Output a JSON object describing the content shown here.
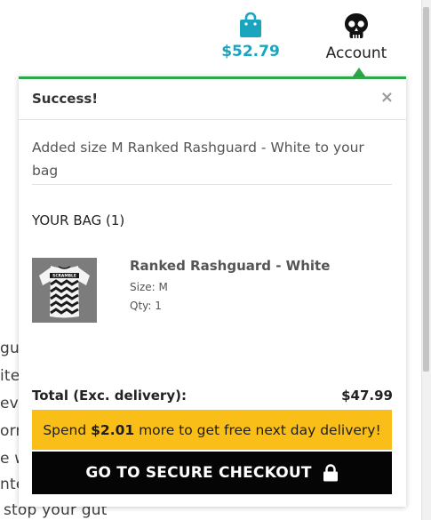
{
  "header": {
    "bag_total": "$52.79",
    "account_label": "Account",
    "brand_color": "#1aa5bf",
    "success_color": "#2fa84a"
  },
  "background_text": [
    "gui",
    "ite",
    "eve",
    "orr",
    "e w",
    "nte",
    "stop your gut"
  ],
  "popup": {
    "title": "Success!",
    "close_label": "×",
    "added_message": "Added size M Ranked Rashguard - White to your bag",
    "bag_heading": "YOUR BAG (1)",
    "item": {
      "name": "Ranked Rashguard - White",
      "size": "Size: M",
      "qty": "Qty: 1",
      "thumbnail_text": "SCRAMBLE"
    },
    "total_label": "Total (Exc. delivery):",
    "total_value": "$47.99",
    "delivery_prefix": "Spend ",
    "delivery_amount": "$2.01",
    "delivery_suffix": " more to get free next day delivery!",
    "delivery_color": "#f9be17",
    "checkout_label": "GO TO SECURE CHECKOUT"
  }
}
